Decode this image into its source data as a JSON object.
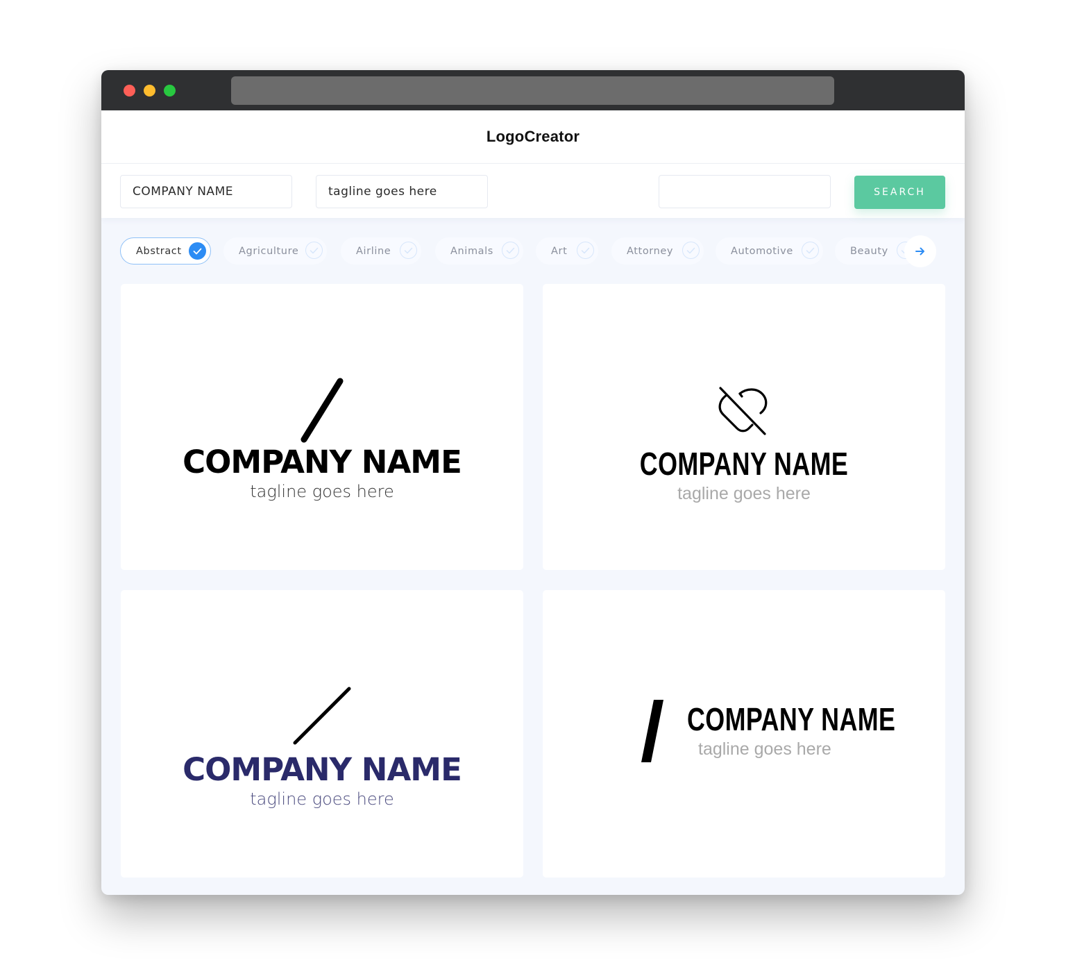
{
  "app": {
    "title": "LogoCreator"
  },
  "search": {
    "company_name_value": "COMPANY NAME",
    "tagline_value": "tagline goes here",
    "query_value": "",
    "search_label": "SEARCH"
  },
  "categories": {
    "items": [
      {
        "label": "Abstract",
        "selected": true
      },
      {
        "label": "Agriculture",
        "selected": false
      },
      {
        "label": "Airline",
        "selected": false
      },
      {
        "label": "Animals",
        "selected": false
      },
      {
        "label": "Art",
        "selected": false
      },
      {
        "label": "Attorney",
        "selected": false
      },
      {
        "label": "Automotive",
        "selected": false
      },
      {
        "label": "Beauty",
        "selected": false
      }
    ],
    "next_icon": "arrow-right-icon"
  },
  "colors": {
    "accent_green": "#5bc9a0",
    "accent_blue": "#2c8cf4",
    "navy": "#2a2a6a"
  },
  "logos": [
    {
      "icon": "slash-stroke-icon",
      "company": "COMPANY NAME",
      "tagline": "tagline goes here",
      "layout": "stacked"
    },
    {
      "icon": "heart-off-icon",
      "company": "COMPANY NAME",
      "tagline": "tagline goes here",
      "layout": "stacked"
    },
    {
      "icon": "slash-thin-icon",
      "company": "COMPANY NAME",
      "tagline": "tagline goes here",
      "layout": "stacked",
      "text_color": "#2a2a6a"
    },
    {
      "icon": "slash-bar-icon",
      "company": "COMPANY NAME",
      "tagline": "tagline goes here",
      "layout": "inline"
    }
  ]
}
